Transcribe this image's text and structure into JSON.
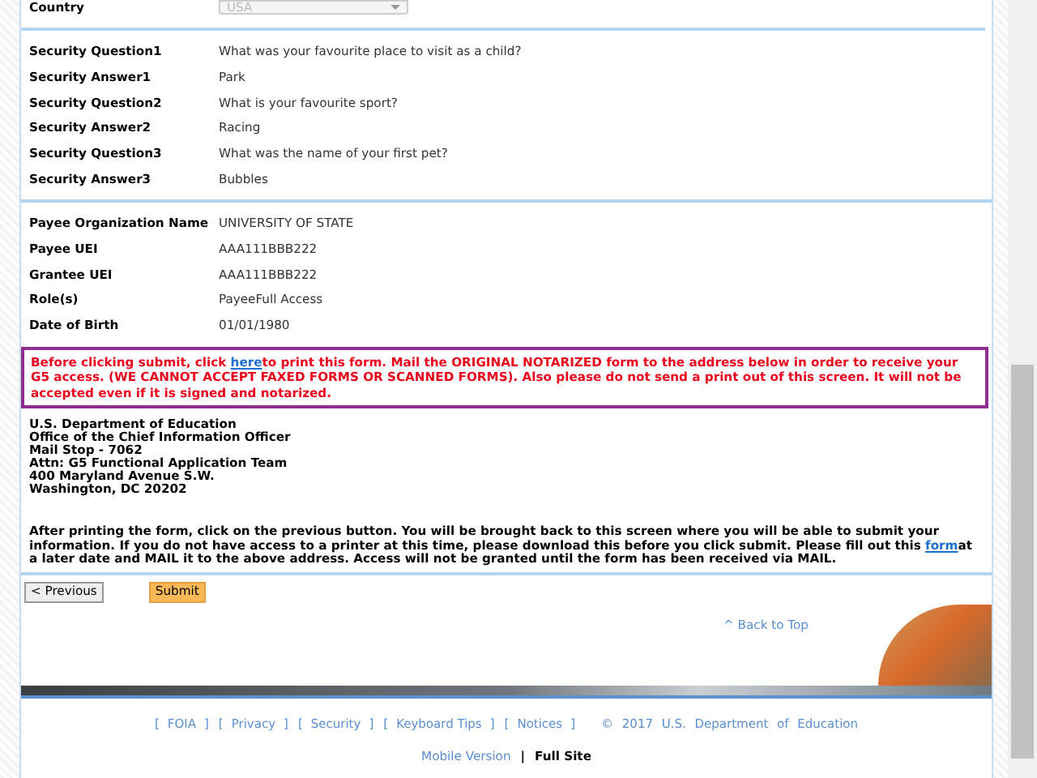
{
  "top_field": {
    "label": "Country",
    "value": "USA",
    "disabled": true
  },
  "security": [
    {
      "label": "Security Question1",
      "value": "What was your favourite place to visit as a child?"
    },
    {
      "label": "Security Answer1",
      "value": "Park"
    },
    {
      "label": "Security Question2",
      "value": "What is your favourite sport?"
    },
    {
      "label": "Security Answer2",
      "value": "Racing"
    },
    {
      "label": "Security Question3",
      "value": "What was the name of your first pet?"
    },
    {
      "label": "Security Answer3",
      "value": "Bubbles"
    }
  ],
  "account": [
    {
      "label": "Payee Organization Name",
      "value": "UNIVERSITY OF STATE"
    },
    {
      "label": "Payee UEI",
      "value": "AAA111BBB222"
    },
    {
      "label": "Grantee UEI",
      "value": "AAA111BBB222"
    },
    {
      "label": "Role(s)",
      "value": "PayeeFull Access"
    },
    {
      "label": "Date of Birth",
      "value": "01/01/1980"
    }
  ],
  "notice": {
    "before": "Before clicking submit, click ",
    "link": "here",
    "after": "to print this form. Mail the ORIGINAL NOTARIZED form to the address below in order to receive your G5 access. (WE CANNOT ACCEPT FAXED FORMS OR SCANNED FORMS). Also please do not send a print out of this screen. It will not be accepted even if it is signed and notarized."
  },
  "address": [
    "U.S. Department of Education",
    "Office of the Chief Information Officer",
    "Mail Stop - 7062",
    "Attn: G5 Functional Application Team",
    "400 Maryland Avenue S.W.",
    "Washington, DC 20202"
  ],
  "instructions": {
    "before": "After printing the form, click on the previous button. You will be brought back to this screen where you will be able to submit your information. If you do not have access to a printer at this time, please download this before you click submit. Please fill out this ",
    "link": "form",
    "after": "at a later date and MAIL it to the above address. Access will not be granted until the form has been received via MAIL."
  },
  "buttons": [
    {
      "label": "< Previous",
      "kind": "secondary"
    },
    {
      "label": "Submit",
      "kind": "primary"
    }
  ],
  "back_to_top": "^ Back to Top",
  "footer_links": [
    {
      "label": "FOIA"
    },
    {
      "label": "Privacy"
    },
    {
      "label": "Security"
    },
    {
      "label": "Keyboard Tips"
    },
    {
      "label": "Notices"
    }
  ],
  "brackets": [
    "[",
    "]"
  ],
  "copyright": "© 2017 U.S. Department of Education",
  "site_versions": [
    {
      "label": "Mobile Version",
      "selected": false
    },
    {
      "label": "Full Site",
      "selected": true
    }
  ],
  "version_separator": "|"
}
